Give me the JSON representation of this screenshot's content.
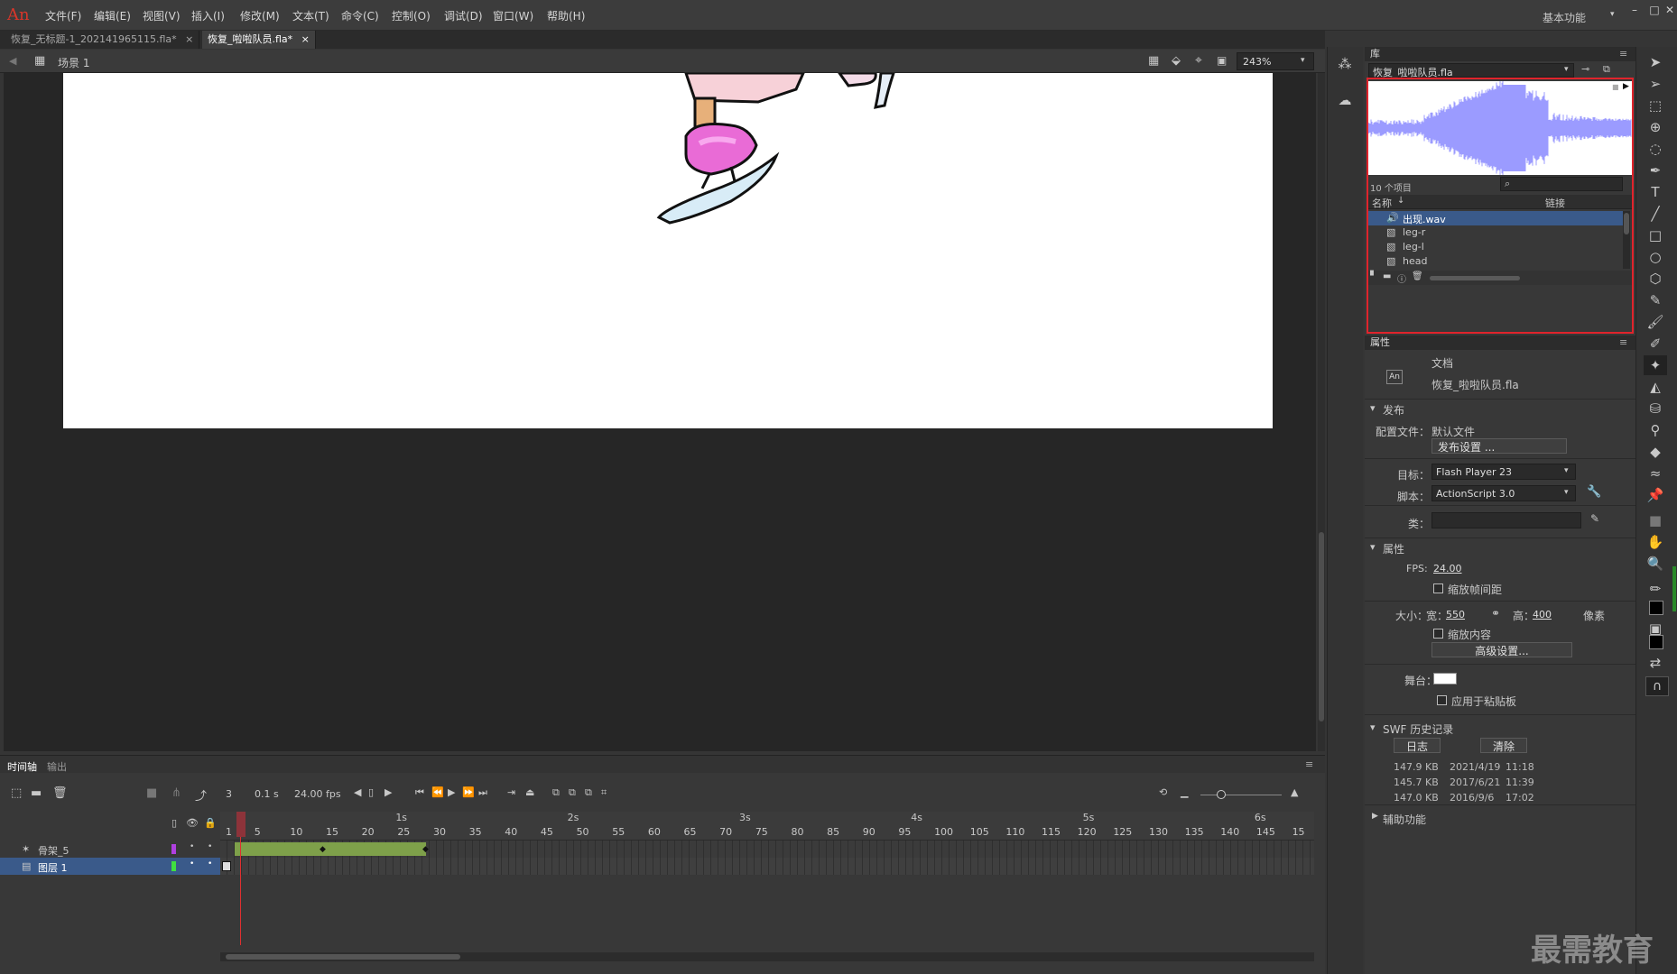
{
  "app": {
    "logo": "An"
  },
  "menu": [
    "文件(F)",
    "编辑(E)",
    "视图(V)",
    "插入(I)",
    "修改(M)",
    "文本(T)",
    "命令(C)",
    "控制(O)",
    "调试(D)",
    "窗口(W)",
    "帮助(H)"
  ],
  "workspace": "基本功能",
  "doc_tabs": [
    {
      "label": "恢复_无标题-1_202141965115.fla*",
      "active": false
    },
    {
      "label": "恢复_啦啦队员.fla*",
      "active": true
    }
  ],
  "scene": {
    "label": "场景 1",
    "zoom": "243%"
  },
  "timeline": {
    "tabs": [
      "时间轴",
      "输出"
    ],
    "current_frame": "3",
    "elapsed": "0.1 s",
    "fps": "24.00 fps",
    "seconds": [
      "1s",
      "2s",
      "3s",
      "4s",
      "5s",
      "6s"
    ],
    "frame_ticks": [
      "1",
      "5",
      "10",
      "15",
      "20",
      "25",
      "30",
      "35",
      "40",
      "45",
      "50",
      "55",
      "60",
      "65",
      "70",
      "75",
      "80",
      "85",
      "90",
      "95",
      "100",
      "105",
      "110",
      "115",
      "120",
      "125",
      "130",
      "135",
      "140",
      "145",
      "15"
    ],
    "layers": [
      {
        "name": "骨架_5",
        "color": "#b040e0",
        "selected": false
      },
      {
        "name": "图层 1",
        "color": "#40e040",
        "selected": true
      }
    ]
  },
  "library": {
    "title": "库",
    "doc_select": "恢复_啦啦队员.fla",
    "item_count": "10 个项目",
    "col_name": "名称",
    "col_link": "链接",
    "items": [
      {
        "name": "出现.wav",
        "type": "sound-icon",
        "selected": true
      },
      {
        "name": "leg-r",
        "type": "graphic-icon",
        "selected": false
      },
      {
        "name": "leg-l",
        "type": "graphic-icon",
        "selected": false
      },
      {
        "name": "head",
        "type": "graphic-icon",
        "selected": false
      }
    ]
  },
  "properties": {
    "title": "属性",
    "doc_type": "文档",
    "doc_name": "恢复_啦啦队员.fla",
    "publish": {
      "header": "发布",
      "profile_label": "配置文件：",
      "profile_value": "默认文件",
      "settings_btn": "发布设置 ...",
      "target_label": "目标：",
      "target_value": "Flash Player 23",
      "script_label": "脚本：",
      "script_value": "ActionScript 3.0",
      "class_label": "类："
    },
    "attrs": {
      "header": "属性",
      "fps_label": "FPS:",
      "fps_value": "24.00",
      "scale_spans": "缩放帧间距",
      "size_label": "大小：",
      "width_label": "宽：",
      "width_value": "550",
      "height_label": "高：",
      "height_value": "400",
      "unit": "像素",
      "scale_content": "缩放内容",
      "advanced_btn": "高级设置...",
      "stage_label": "舞台：",
      "stage_color": "#ffffff",
      "apply_paste": "应用于粘贴板"
    },
    "swf_history": {
      "header": "SWF 历史记录",
      "log_btn": "日志",
      "clear_btn": "清除",
      "rows": [
        [
          "147.9 KB",
          "2021/4/19",
          "11:18"
        ],
        [
          "145.7 KB",
          "2017/6/21",
          "11:39"
        ],
        [
          "147.0 KB",
          "2016/9/6",
          "17:02"
        ]
      ]
    },
    "accessibility": "辅助功能"
  },
  "watermark": "最需教育",
  "colors": {
    "highlight": "#e0242c",
    "waveform": "#9b9bff",
    "tween": "#7ea04a",
    "selected_row": "#3a5a8a"
  }
}
